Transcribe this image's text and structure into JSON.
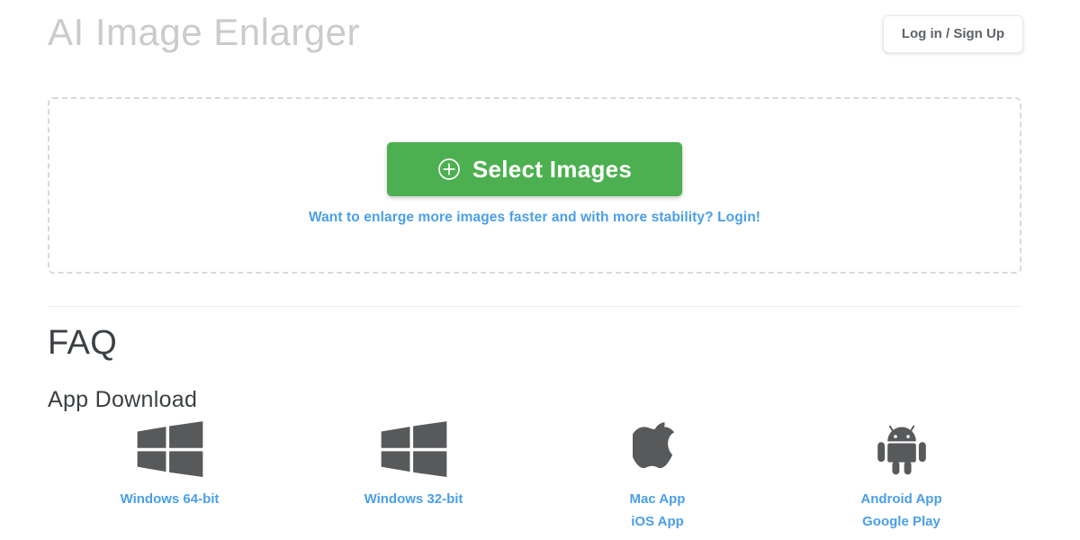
{
  "header": {
    "app_title": "AI Image Enlarger",
    "login_button_label": "Log in / Sign Up"
  },
  "dropzone": {
    "select_images_label": "Select Images",
    "select_images_icon": "plus-circle-icon",
    "hint_link": "Want to enlarge more images faster and with more stability? Login!"
  },
  "faq": {
    "heading": "FAQ",
    "app_download_heading": "App Download",
    "downloads": [
      {
        "icon": "windows-icon",
        "links": [
          "Windows 64-bit"
        ]
      },
      {
        "icon": "windows-icon",
        "links": [
          "Windows 32-bit"
        ]
      },
      {
        "icon": "apple-icon",
        "links": [
          "Mac App",
          "iOS App"
        ]
      },
      {
        "icon": "android-icon",
        "links": [
          "Android App",
          "Google Play"
        ]
      }
    ]
  },
  "colors": {
    "accent_green": "#4cb050",
    "link_blue": "#4a9fe8",
    "title_gray": "#c9cbcd",
    "heading_dark": "#3c4043",
    "icon_gray": "#58595b",
    "dropzone_border": "#d7d9dc"
  }
}
